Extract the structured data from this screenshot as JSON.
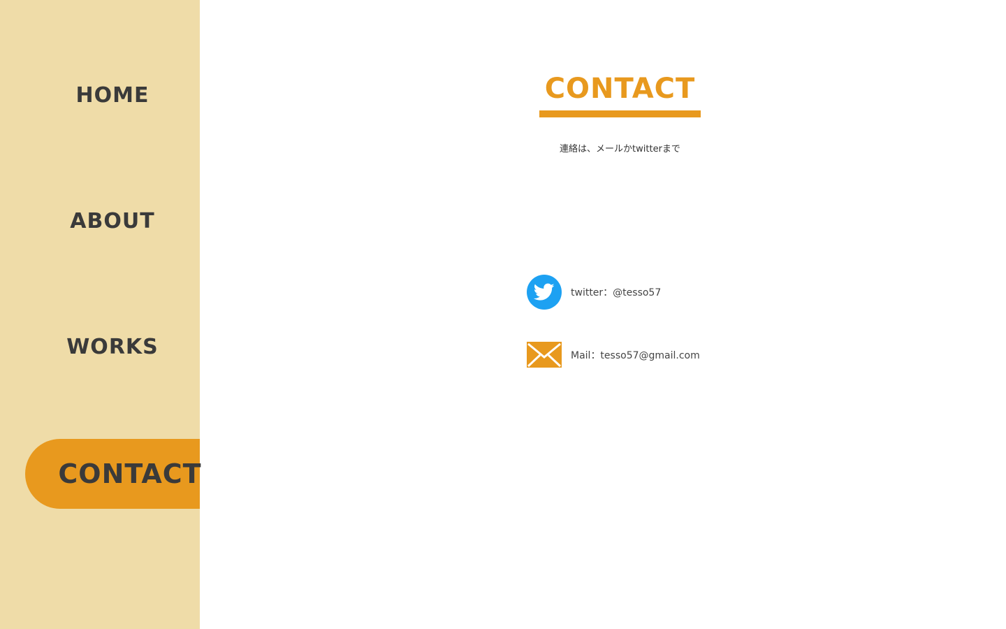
{
  "nav": {
    "items": [
      {
        "label": "HOME",
        "active": false
      },
      {
        "label": "ABOUT",
        "active": false
      },
      {
        "label": "WORKS",
        "active": false
      },
      {
        "label": "CONTACT",
        "active": true
      }
    ]
  },
  "main": {
    "title": "CONTACT",
    "intro": "連絡は、メールかtwitterまで",
    "contacts": [
      {
        "icon": "twitter-icon",
        "text": "twitter：@tesso57"
      },
      {
        "icon": "mail-icon",
        "text": "Mail：tesso57@gmail.com"
      }
    ]
  },
  "colors": {
    "sidebar_bg": "#efdca8",
    "accent": "#e8991e",
    "twitter_blue": "#1da1f2",
    "nav_text": "#3a3a3a"
  }
}
